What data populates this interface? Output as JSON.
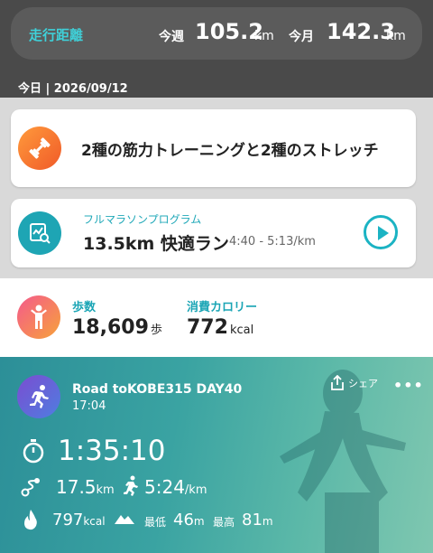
{
  "header": {
    "title": "走行距離",
    "week_label": "今週",
    "week_value": "105.2",
    "week_unit": "km",
    "month_label": "今月",
    "month_value": "142.3",
    "month_unit": "km",
    "date_text": "今日 | 2026/09/12"
  },
  "workout": {
    "title": "2種の筋力トレーニングと2種のストレッチ"
  },
  "program": {
    "label": "フルマラソンプログラム",
    "main": "13.5km 快適ラン",
    "pace": "4:40 - 5:13/km"
  },
  "stats": {
    "steps_label": "歩数",
    "steps_value": "18,609",
    "steps_unit": "歩",
    "cal_label": "消費カロリー",
    "cal_value": "772",
    "cal_unit": "kcal"
  },
  "activity": {
    "title": "Road toKOBE315 DAY40",
    "time": "17:04",
    "share_label": "シェア",
    "more_label": "•••",
    "duration": "1:35:10",
    "distance_value": "17.5",
    "distance_unit": "km",
    "pace_value": "5:24",
    "pace_unit": "/km",
    "calorie_value": "797",
    "calorie_unit": "kcal",
    "min_label": "最低",
    "min_value": "46",
    "min_unit": "m",
    "max_label": "最高",
    "max_value": "81",
    "max_unit": "m"
  },
  "colors": {
    "accent": "#1bb3c3",
    "header_bg": "#4a4a4a",
    "activity_bg": "#3aa3a2"
  }
}
